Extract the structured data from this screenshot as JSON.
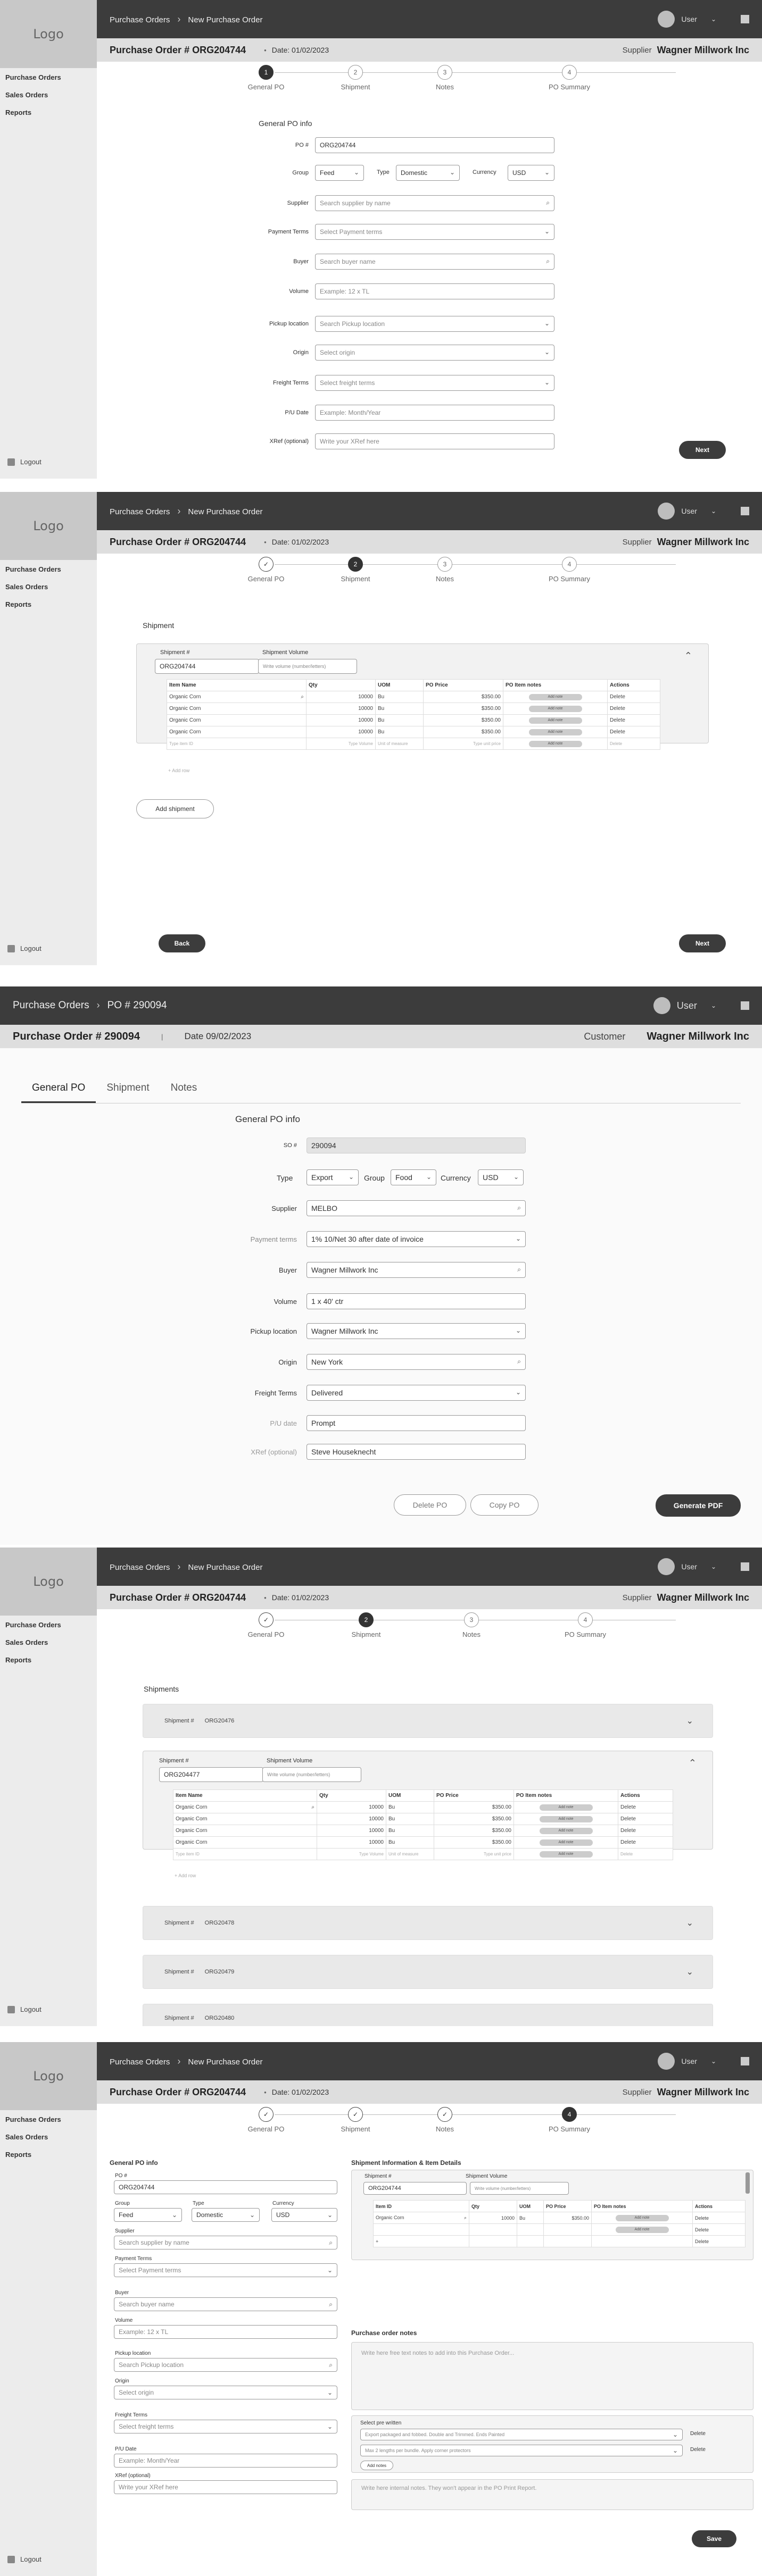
{
  "app": {
    "logo": "Logo",
    "user": "User",
    "logout": "Logout"
  },
  "nav": {
    "items": [
      "Purchase Orders",
      "Sales Orders",
      "Reports"
    ]
  },
  "crumbs": {
    "first": "Purchase Orders",
    "second": "New Purchase Order"
  },
  "header": {
    "po": "Purchase Order # ORG204744",
    "date": "Date: 01/02/2023",
    "supplier_label": "Supplier",
    "supplier": "Wagner Millwork Inc"
  },
  "steps": [
    "General PO",
    "Shipment",
    "Notes",
    "PO Summary"
  ],
  "step_nums": [
    "1",
    "2",
    "3",
    "4"
  ],
  "check": "✓",
  "form": {
    "title": "General PO info",
    "po_label": "PO #",
    "po_value": "ORG204744",
    "group_label": "Group",
    "group_value": "Feed",
    "type_label": "Type",
    "type_value": "Domestic",
    "currency_label": "Currency",
    "currency_value": "USD",
    "supplier_label": "Supplier",
    "supplier_ph": "Search supplier by name",
    "payment_label": "Payment Terms",
    "payment_ph": "Select Payment terms",
    "buyer_label": "Buyer",
    "buyer_ph": "Search buyer name",
    "volume_label": "Volume",
    "volume_ph": "Example: 12 x TL",
    "pickup_label": "Pickup location",
    "pickup_ph": "Search Pickup location",
    "origin_label": "Origin",
    "origin_ph": "Select origin",
    "freight_label": "Freight Terms",
    "freight_ph": "Select freight terms",
    "pu_label": "P/U Date",
    "pu_ph": "Example: Month/Year",
    "xref_label": "XRef (optional)",
    "xref_ph": "Write your XRef here"
  },
  "buttons": {
    "next": "Next",
    "back": "Back",
    "add_shipment": "Add shipment",
    "delete_po": "Delete PO",
    "copy_po": "Copy PO",
    "generate_pdf": "Generate PDF",
    "save": "Save",
    "add_note": "Add note",
    "add_notes": "Add notes"
  },
  "shipment": {
    "title": "Shipment",
    "titles": "Shipments",
    "num_label": "Shipment #",
    "vol_label": "Shipment Volume",
    "num_value": "ORG204744",
    "vol_ph": "Write volume (number/letters)",
    "num_value2": "ORG204477",
    "collapsed": [
      "ORG20476",
      "ORG20478",
      "ORG20479",
      "ORG20480"
    ],
    "add_row": "Add row"
  },
  "table": {
    "headers": [
      "Item Name",
      "Qty",
      "UOM",
      "PO Price",
      "PO Item notes",
      "Actions"
    ],
    "headers2": [
      "Item ID",
      "Qty",
      "UOM",
      "PO Price",
      "PO Item notes",
      "Actions"
    ],
    "rows": [
      [
        "Organic Corn",
        "10000",
        "Bu",
        "$350.00",
        "Add note",
        "Delete"
      ],
      [
        "Organic Corn",
        "10000",
        "Bu",
        "$350.00",
        "Add note",
        "Delete"
      ],
      [
        "Organic Corn",
        "10000",
        "Bu",
        "$350.00",
        "Add note",
        "Delete"
      ],
      [
        "Organic Corn",
        "10000",
        "Bu",
        "$350.00",
        "Add note",
        "Delete"
      ]
    ],
    "placeholder": [
      "Type item ID",
      "Type Volume",
      "Unit of measure",
      "Type unit price",
      "Add note",
      "Delete"
    ]
  },
  "p3": {
    "crumb1": "Purchase Orders",
    "crumb2": "PO # 290094",
    "po": "Purchase Order # 290094",
    "date": "Date 09/02/2023",
    "customer_label": "Customer",
    "customer": "Wagner Millwork Inc",
    "tabs": [
      "General PO",
      "Shipment",
      "Notes"
    ],
    "so_label": "SO #",
    "so_value": "290094",
    "type_value": "Export",
    "group_value": "Food",
    "currency_value": "USD",
    "supplier_value": "MELBO",
    "payment_label": "Payment terms",
    "payment_value": "1% 10/Net 30 after date of invoice",
    "buyer_value": "Wagner Millwork Inc",
    "volume_value": "1 x 40' ctr",
    "pickup_value": "Wagner Millwork Inc",
    "origin_value": "New York",
    "freight_value": "Delivered",
    "pu_label": "P/U date",
    "pu_value": "Prompt",
    "xref_value": "Steve Houseknecht"
  },
  "p5": {
    "shipinfo_title": "Shipment Information & Item Details",
    "notes_title": "Purchase order notes",
    "notes_ph": "Write here free text notes to add into this Purchase Order...",
    "preset_label": "Select pre written",
    "preset1": "Export packaged and fobbed. Double and Trimmed. Ends Painted",
    "preset2": "Max 2 lengths per bundle. Apply corner protectors",
    "internal_ph": "Write here internal notes. They won't appear in the PO Print Report.",
    "delete": "Delete"
  },
  "icons": {
    "search": "⌕",
    "chevron": "⌄",
    "crumb_sep": "›",
    "collapse": "⌃",
    "plus": "+"
  }
}
